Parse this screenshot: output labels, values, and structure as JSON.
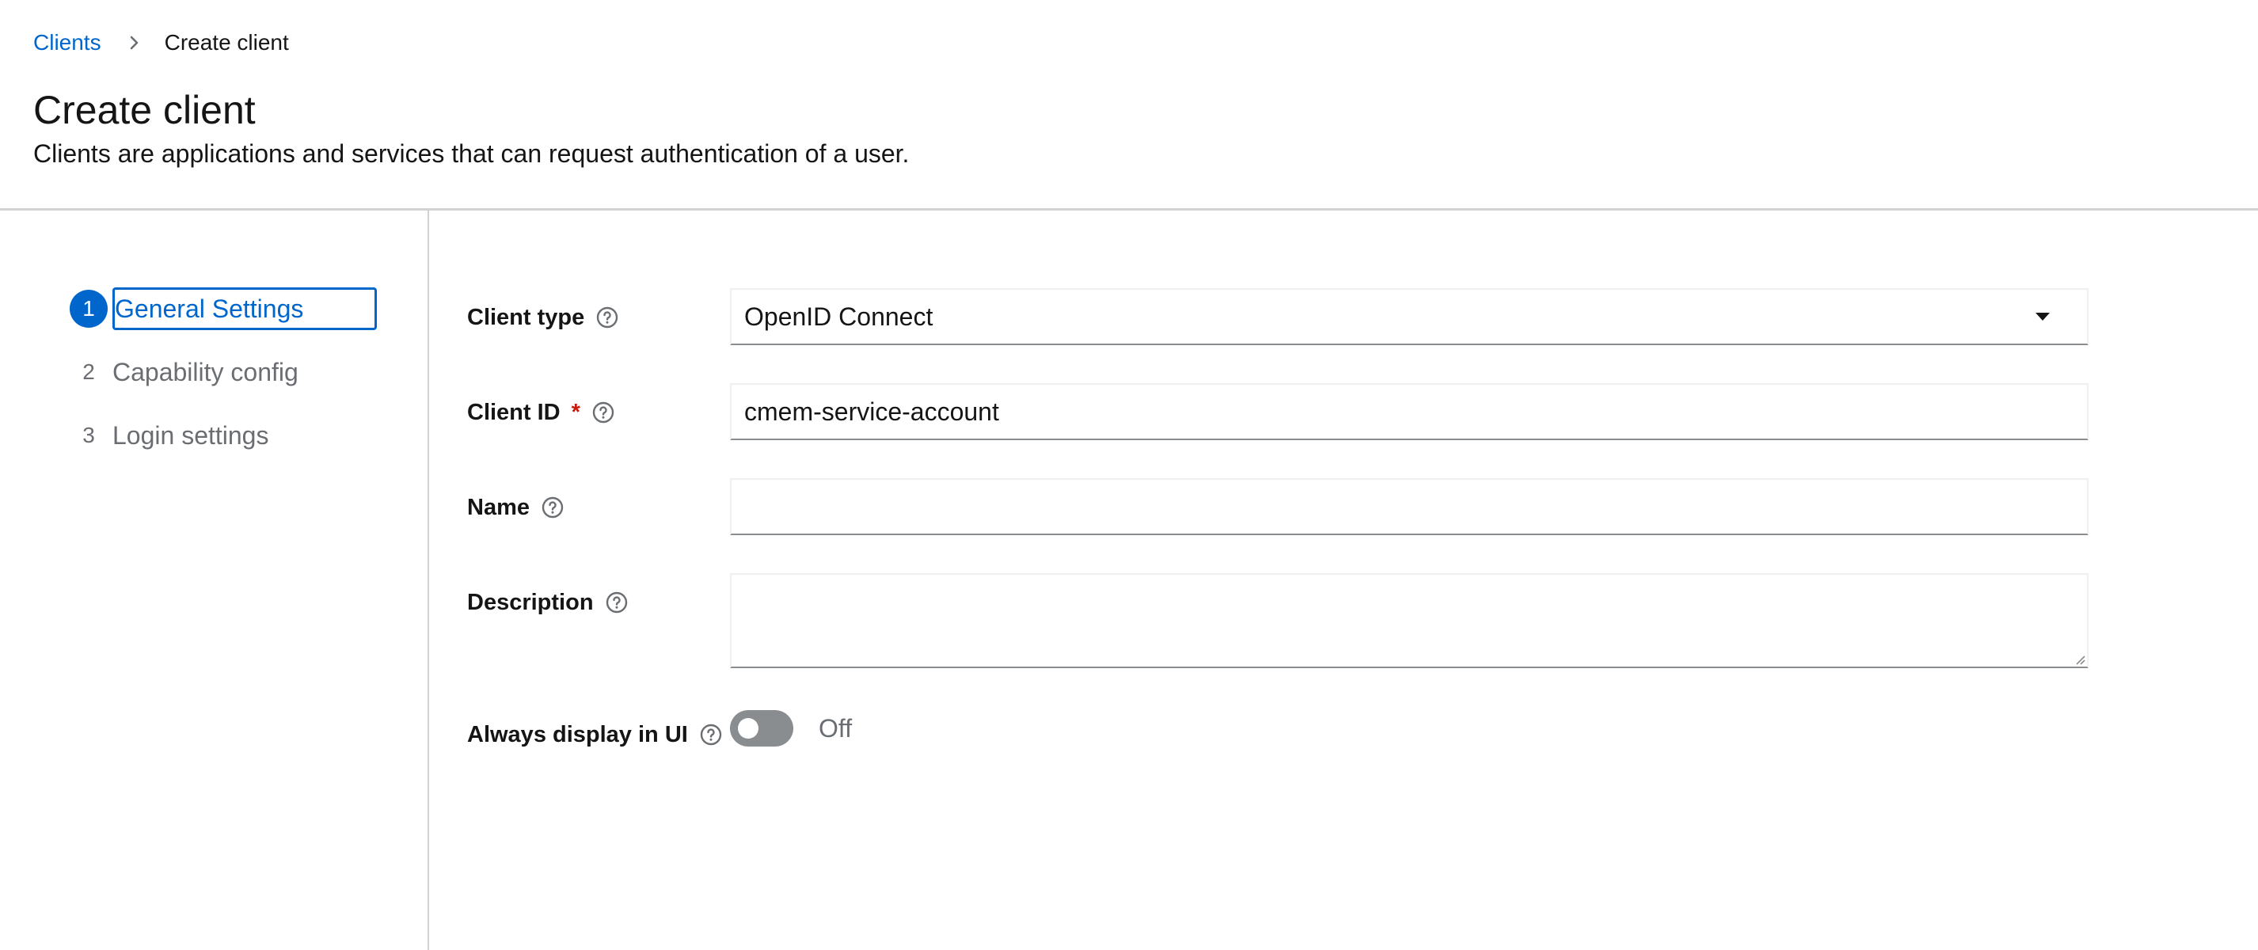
{
  "breadcrumb": {
    "items": [
      {
        "label": "Clients"
      },
      {
        "label": "Create client"
      }
    ]
  },
  "page": {
    "title": "Create client",
    "description": "Clients are applications and services that can request authentication of a user."
  },
  "wizard": {
    "steps": [
      {
        "number": "1",
        "label": "General Settings",
        "active": true
      },
      {
        "number": "2",
        "label": "Capability config",
        "active": false
      },
      {
        "number": "3",
        "label": "Login settings",
        "active": false
      }
    ]
  },
  "form": {
    "client_type": {
      "label": "Client type",
      "value": "OpenID Connect"
    },
    "client_id": {
      "label": "Client ID",
      "required_mark": "*",
      "value": "cmem-service-account"
    },
    "name": {
      "label": "Name",
      "value": ""
    },
    "description": {
      "label": "Description",
      "value": ""
    },
    "always_display": {
      "label": "Always display in UI",
      "state_text": "Off",
      "checked": false
    }
  },
  "colors": {
    "accent": "#0066cc",
    "required": "#c9190b",
    "muted_text": "#6a6e73",
    "switch_off": "#8a8d90"
  },
  "icons": {
    "breadcrumb_separator": "chevron-right-icon",
    "help": "question-circle-icon",
    "select_caret": "caret-down-icon"
  }
}
